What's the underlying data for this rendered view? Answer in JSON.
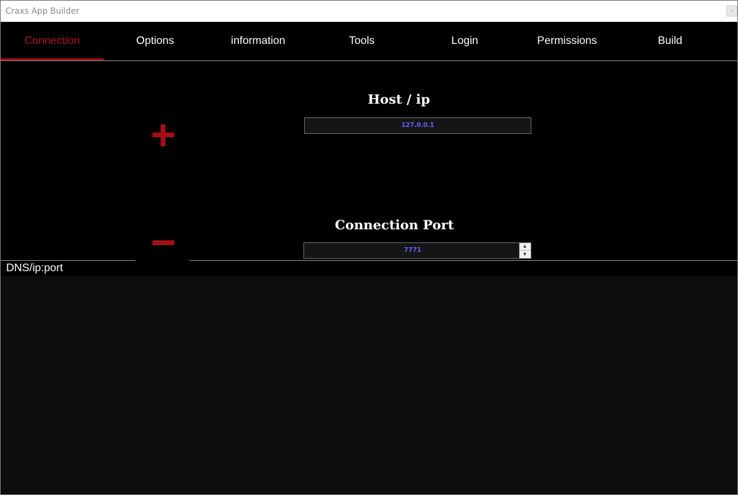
{
  "window": {
    "title": "Craxs App Builder",
    "close_label": "x"
  },
  "tabs": [
    {
      "label": "Connection",
      "active": true
    },
    {
      "label": "Options",
      "active": false
    },
    {
      "label": "information",
      "active": false
    },
    {
      "label": "Tools",
      "active": false
    },
    {
      "label": "Login",
      "active": false
    },
    {
      "label": "Permissions",
      "active": false
    },
    {
      "label": "Build",
      "active": false
    }
  ],
  "connection": {
    "host_label": "Host / ip",
    "host_value": "127.0.0.1",
    "port_label": "Connection Port",
    "port_value": "7771",
    "add_icon": "plus-icon",
    "remove_icon": "minus-icon"
  },
  "dns": {
    "label": "DNS/ip:port",
    "entries": []
  },
  "colors": {
    "accent": "#a40f17",
    "active_tab_text": "#b0121b",
    "input_text": "#5b63ff",
    "background": "#000000",
    "list_background": "#0d0d0d"
  }
}
